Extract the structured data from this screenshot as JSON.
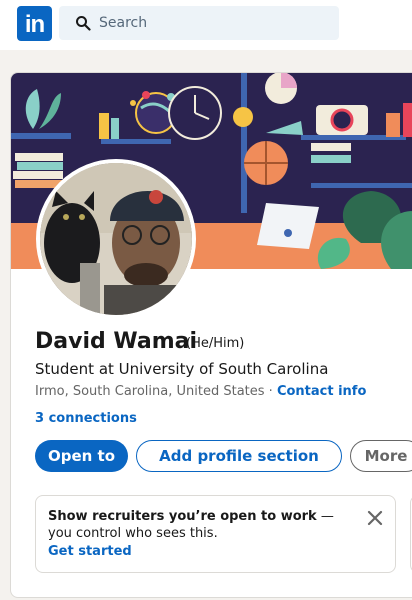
{
  "header": {
    "logo_text": "in",
    "search_placeholder": "Search"
  },
  "profile": {
    "name": "David Wamai",
    "pronouns": "(He/Him)",
    "headline": "Student at University of South Carolina",
    "location": "Irmo, South Carolina, United States",
    "separator": " · ",
    "contact_info": "Contact info",
    "connections": "3 connections"
  },
  "actions": {
    "open_to": "Open to",
    "add_section": "Add profile section",
    "more": "More"
  },
  "open_to_work_card": {
    "bold_text": "Show recruiters you’re open to work",
    "rest_text": " — you control who sees this.",
    "cta": "Get started"
  },
  "colors": {
    "brand": "#0a66c2",
    "banner_bg": "#2b2350",
    "banner_floor": "#f08c5a"
  },
  "icons": [
    "linkedin-logo",
    "search-icon",
    "close-icon",
    "globe-icon",
    "clock-icon",
    "basketball-icon",
    "camera-icon",
    "laptop-icon",
    "plant-icon"
  ]
}
